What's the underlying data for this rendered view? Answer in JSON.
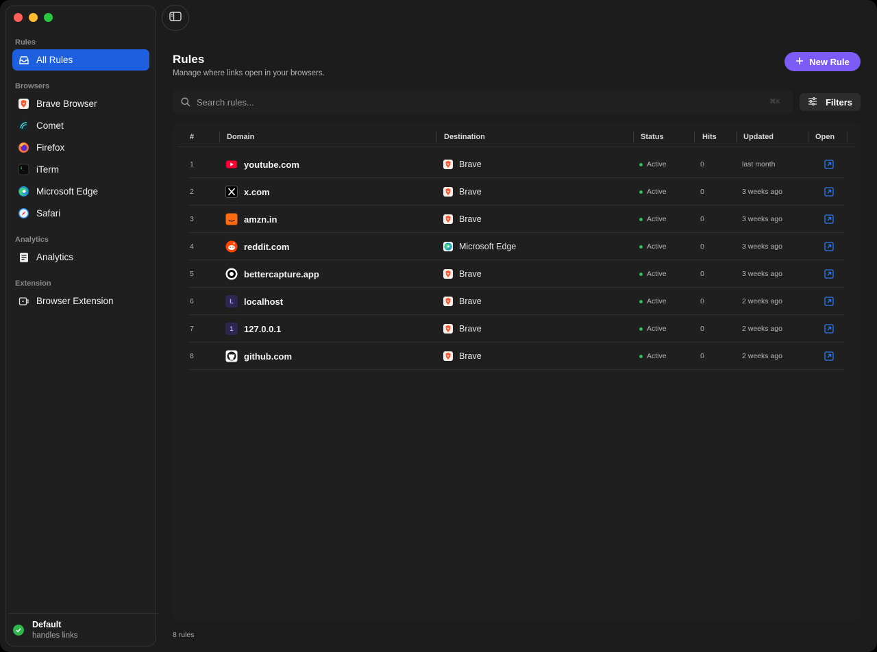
{
  "sidebar": {
    "sections": {
      "rules": "Rules",
      "browsers": "Browsers",
      "analytics": "Analytics",
      "extension": "Extension"
    },
    "all_rules": "All Rules",
    "browsers": [
      "Brave Browser",
      "Comet",
      "Firefox",
      "iTerm",
      "Microsoft Edge",
      "Safari"
    ],
    "analytics_item": "Analytics",
    "extension_item": "Browser Extension",
    "footer": {
      "title": "Default",
      "subtitle": "handles links"
    }
  },
  "header": {
    "title": "Rules",
    "subtitle": "Manage where links open in your browsers.",
    "new_rule_label": "New Rule"
  },
  "search": {
    "placeholder": "Search rules...",
    "shortcut": "⌘K"
  },
  "filters_label": "Filters",
  "table": {
    "columns": [
      "#",
      "Domain",
      "Destination",
      "Status",
      "Hits",
      "Updated",
      "Open"
    ],
    "rows": [
      {
        "num": "1",
        "domain": "youtube.com",
        "favicon": "youtube-icon",
        "destination": "Brave",
        "dest_icon": "brave-icon",
        "status": "Active",
        "hits": "0",
        "updated": "last month"
      },
      {
        "num": "2",
        "domain": "x.com",
        "favicon": "x-icon",
        "destination": "Brave",
        "dest_icon": "brave-icon",
        "status": "Active",
        "hits": "0",
        "updated": "3 weeks ago"
      },
      {
        "num": "3",
        "domain": "amzn.in",
        "favicon": "amazon-icon",
        "destination": "Brave",
        "dest_icon": "brave-icon",
        "status": "Active",
        "hits": "0",
        "updated": "3 weeks ago"
      },
      {
        "num": "4",
        "domain": "reddit.com",
        "favicon": "reddit-icon",
        "destination": "Microsoft Edge",
        "dest_icon": "edge-icon",
        "status": "Active",
        "hits": "0",
        "updated": "3 weeks ago"
      },
      {
        "num": "5",
        "domain": "bettercapture.app",
        "favicon": "bettercapture-icon",
        "destination": "Brave",
        "dest_icon": "brave-icon",
        "status": "Active",
        "hits": "0",
        "updated": "3 weeks ago"
      },
      {
        "num": "6",
        "domain": "localhost",
        "favicon": "letter-l-icon",
        "favicon_letter": "L",
        "destination": "Brave",
        "dest_icon": "brave-icon",
        "status": "Active",
        "hits": "0",
        "updated": "2 weeks ago"
      },
      {
        "num": "7",
        "domain": "127.0.0.1",
        "favicon": "letter-1-icon",
        "favicon_letter": "1",
        "destination": "Brave",
        "dest_icon": "brave-icon",
        "status": "Active",
        "hits": "0",
        "updated": "2 weeks ago"
      },
      {
        "num": "8",
        "domain": "github.com",
        "favicon": "github-icon",
        "destination": "Brave",
        "dest_icon": "brave-icon",
        "status": "Active",
        "hits": "0",
        "updated": "2 weeks ago"
      }
    ]
  },
  "rule_count": "8 rules",
  "colors": {
    "accent": "#7c5cf6",
    "active_nav": "#1e5fe0",
    "status_active": "#2bbf56",
    "open_link": "#2f7bf5"
  }
}
